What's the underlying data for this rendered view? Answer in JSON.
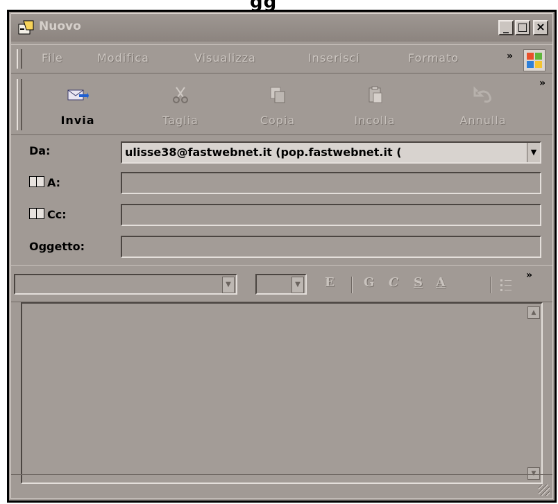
{
  "top_strip_text": "gg",
  "window": {
    "title": "Nuovo",
    "controls": {
      "minimize": "_",
      "maximize": "□",
      "close": "×"
    }
  },
  "menubar": {
    "items": [
      {
        "label": "File"
      },
      {
        "label": "Modifica"
      },
      {
        "label": "Visualizza"
      },
      {
        "label": "Inserisci"
      },
      {
        "label": "Formato"
      }
    ],
    "overflow": "»"
  },
  "toolbar": {
    "buttons": [
      {
        "label": "Invia",
        "icon": "send-icon",
        "enabled": true
      },
      {
        "label": "Taglia",
        "icon": "cut-icon",
        "enabled": false
      },
      {
        "label": "Copia",
        "icon": "copy-icon",
        "enabled": false
      },
      {
        "label": "Incolla",
        "icon": "paste-icon",
        "enabled": false
      },
      {
        "label": "Annulla",
        "icon": "undo-icon",
        "enabled": false
      }
    ],
    "overflow": "»"
  },
  "header": {
    "from_label": "Da:",
    "from_value": "ulisse38@fastwebnet.it     (pop.fastwebnet.it (",
    "to_label": "A:",
    "to_value": "",
    "cc_label": "Cc:",
    "cc_value": "",
    "subject_label": "Oggetto:",
    "subject_value": ""
  },
  "format_bar": {
    "font_value": "",
    "size_value": "",
    "buttons": [
      "E",
      "G",
      "C",
      "S",
      "A"
    ],
    "overflow": "»"
  },
  "body_text": "",
  "colors": {
    "window_face": "#a19a95",
    "title_text": "#d5cfca",
    "disabled_text": "#c9c3be"
  }
}
